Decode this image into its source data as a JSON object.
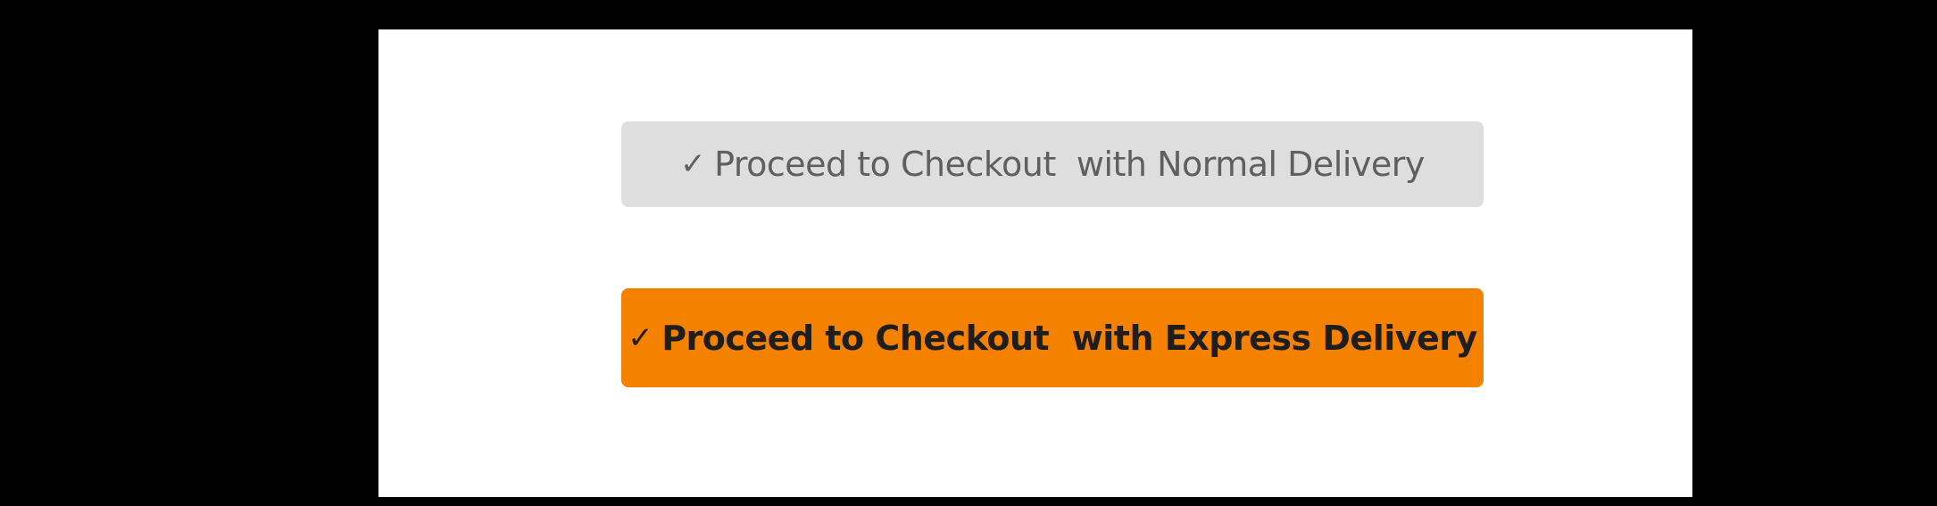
{
  "checkout": {
    "normal_button": {
      "icon": "checkmark-icon",
      "icon_glyph": "✓",
      "label": "Proceed to Checkout  with Normal Delivery"
    },
    "express_button": {
      "icon": "checkmark-icon",
      "icon_glyph": "✓",
      "label": "Proceed to Checkout  with Express Delivery"
    }
  },
  "colors": {
    "page_background": "#000000",
    "panel_background": "#ffffff",
    "normal_button_bg": "#dedede",
    "normal_button_text": "#5f5f5f",
    "express_button_bg": "#f48100",
    "express_button_text": "#1e1e1e"
  }
}
